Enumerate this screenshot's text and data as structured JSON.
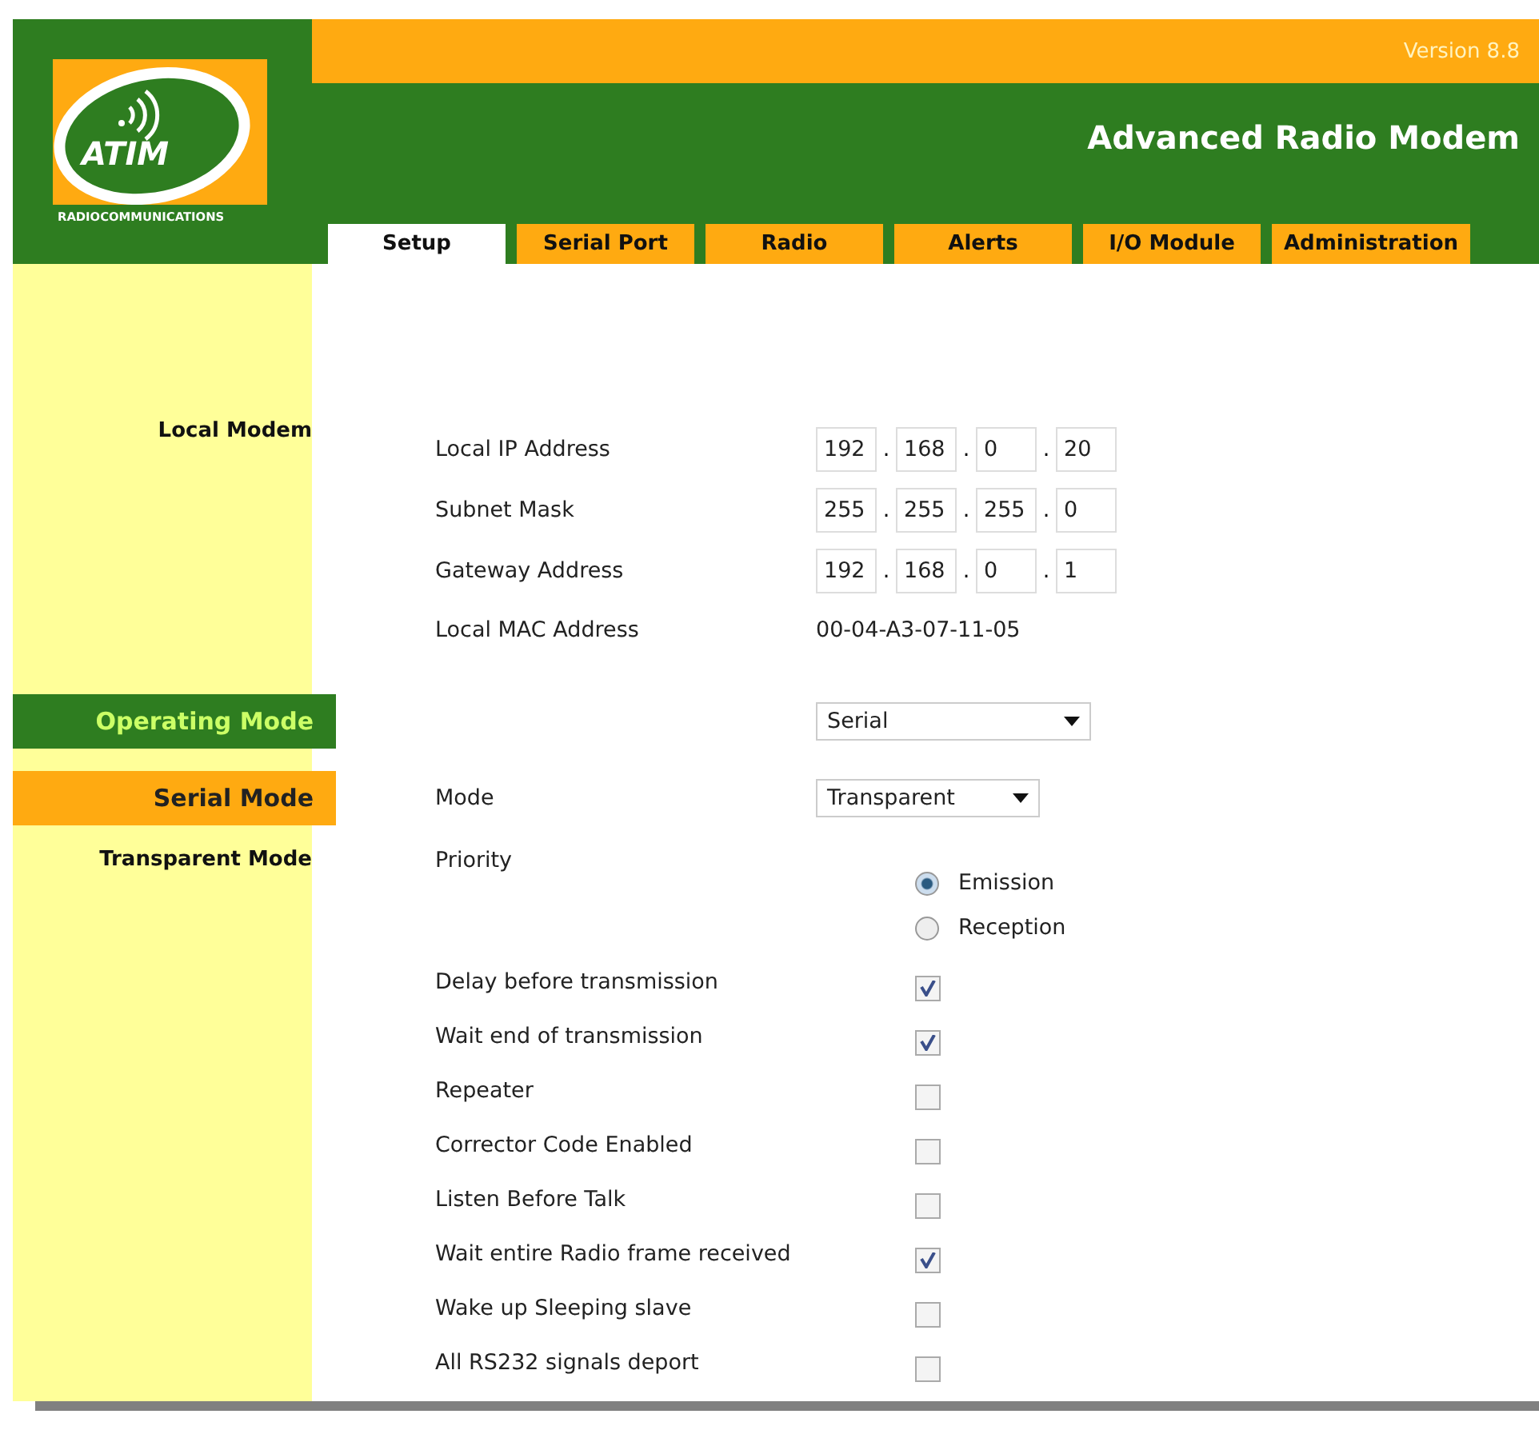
{
  "logo": {
    "name": "ATIM",
    "subtitle": "RADIOCOMMUNICATIONS"
  },
  "version": "Version 8.8",
  "title": "Advanced Radio Modem",
  "tabs": [
    {
      "label": "Setup",
      "selected": true
    },
    {
      "label": "Serial Port",
      "selected": false
    },
    {
      "label": "Radio",
      "selected": false
    },
    {
      "label": "Alerts",
      "selected": false
    },
    {
      "label": "I/O Module",
      "selected": false
    },
    {
      "label": "Administration",
      "selected": false
    }
  ],
  "sections": [
    {
      "title": "Local Modem",
      "kind": "plain",
      "rows": [
        {
          "kind": "ip",
          "label": "Local IP Address",
          "octets": [
            "192",
            "168",
            "0",
            "20"
          ],
          "separators": [
            ".",
            ".",
            "."
          ]
        },
        {
          "kind": "ip",
          "label": "Subnet Mask",
          "octets": [
            "255",
            "255",
            "255",
            "0"
          ],
          "separators": [
            ".",
            ".",
            "."
          ]
        },
        {
          "kind": "ip",
          "label": "Gateway Address",
          "octets": [
            "192",
            "168",
            "0",
            "1"
          ],
          "separators": [
            ".",
            ".",
            "."
          ]
        },
        {
          "kind": "text",
          "label": "Local MAC Address",
          "value": "00-04-A3-07-11-05"
        }
      ]
    },
    {
      "title": "Operating Mode",
      "kind": "band",
      "color": "#2e7d20",
      "rows": [
        {
          "kind": "select",
          "value": "Serial"
        }
      ]
    },
    {
      "title": "Serial Mode",
      "kind": "band",
      "color": "#ffaa11",
      "rows": [
        {
          "kind": "select",
          "label": "Mode",
          "value": "Transparent"
        }
      ]
    },
    {
      "title": "Transparent Mode",
      "kind": "plain",
      "rows": [
        {
          "kind": "radio",
          "label": "Priority",
          "options": [
            {
              "label": "Emission",
              "selected": true
            },
            {
              "label": "Reception",
              "selected": false
            }
          ]
        },
        {
          "kind": "checkbox",
          "label": "Delay before transmission",
          "checked": true
        },
        {
          "kind": "checkbox",
          "label": "Wait end of transmission",
          "checked": true
        },
        {
          "kind": "checkbox",
          "label": "Repeater",
          "checked": false
        },
        {
          "kind": "checkbox",
          "label": "Corrector Code Enabled",
          "checked": false
        },
        {
          "kind": "checkbox",
          "label": "Listen Before Talk",
          "checked": false
        },
        {
          "kind": "checkbox",
          "label": "Wait entire Radio frame received",
          "checked": true
        },
        {
          "kind": "checkbox",
          "label": "Wake up Sleeping slave",
          "checked": false
        },
        {
          "kind": "checkbox",
          "label": "All RS232 signals deport",
          "checked": false
        }
      ]
    }
  ]
}
